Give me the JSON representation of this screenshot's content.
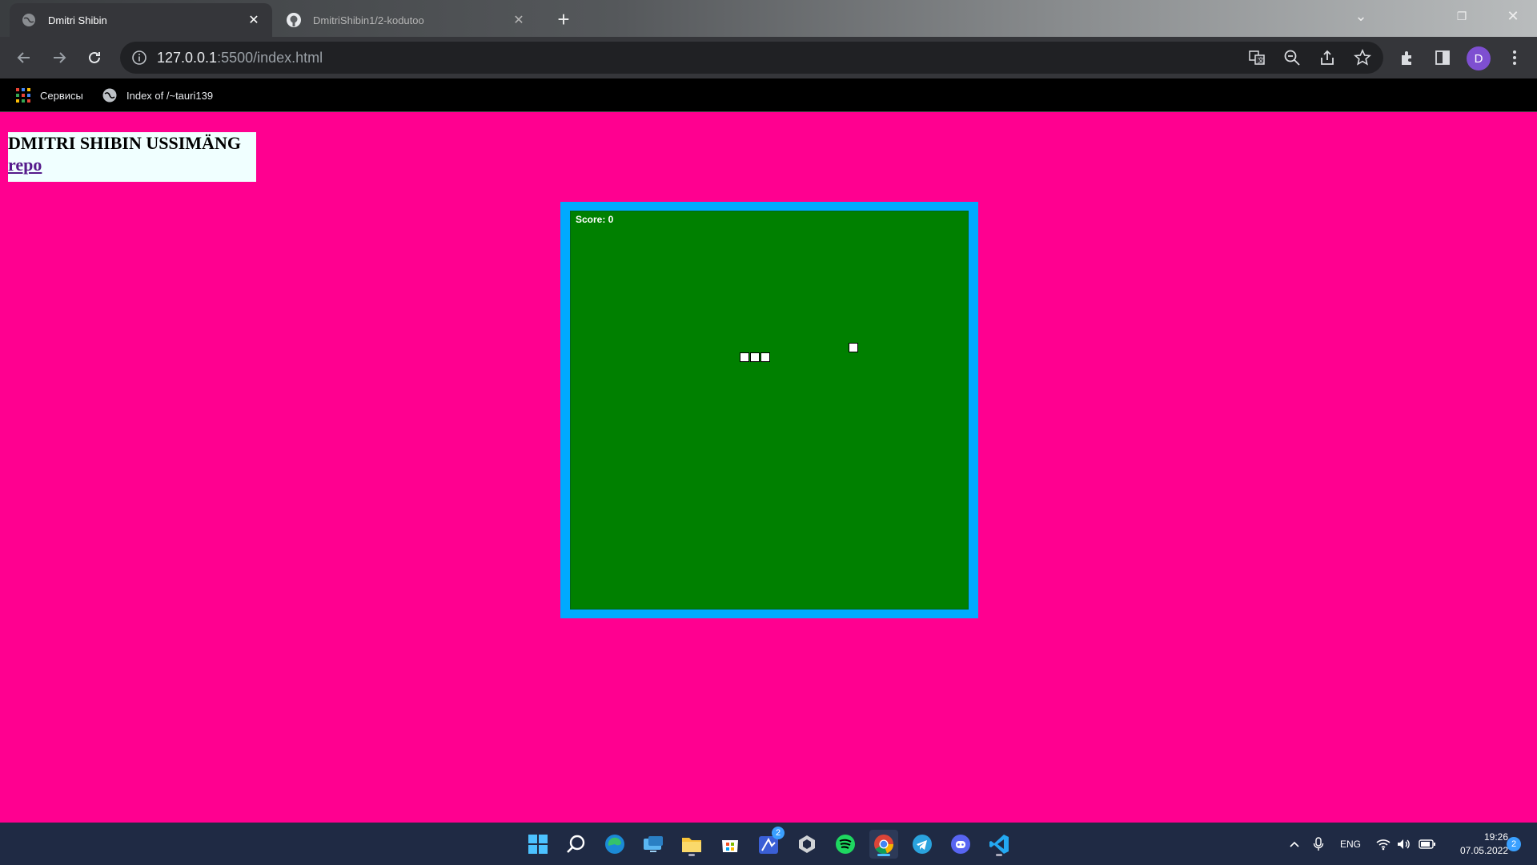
{
  "browser": {
    "tabs": [
      {
        "title": "Dmitri Shibin",
        "active": true,
        "icon": "globe-icon"
      },
      {
        "title": "DmitriShibin1/2-kodutoo",
        "active": false,
        "icon": "github-icon"
      }
    ],
    "address": {
      "host": "127.0.0.1",
      "path": ":5500/index.html"
    },
    "profile_initial": "D",
    "bookmarks": [
      {
        "label": "Сервисы",
        "icon": "apps-grid-icon"
      },
      {
        "label": "Index of /~tauri139",
        "icon": "globe-icon"
      }
    ]
  },
  "page": {
    "title": "DMITRI SHIBIN USSIMÄNG",
    "link": "repo",
    "background": "#ff0090",
    "game": {
      "score_label": "Score: 0",
      "frame_color": "#00aaff",
      "field_color": "#008000"
    }
  },
  "taskbar": {
    "apps": [
      "start-icon",
      "search-icon",
      "edge-icon",
      "remote-desktop-icon",
      "file-explorer-icon",
      "store-icon",
      "app-badge-icon",
      "unity-icon",
      "spotify-icon",
      "chrome-icon",
      "telegram-icon",
      "discord-icon",
      "vscode-icon"
    ],
    "badge_count": "2",
    "language": "ENG",
    "time": "19:26",
    "date": "07.05.2022",
    "notifications": "2"
  }
}
